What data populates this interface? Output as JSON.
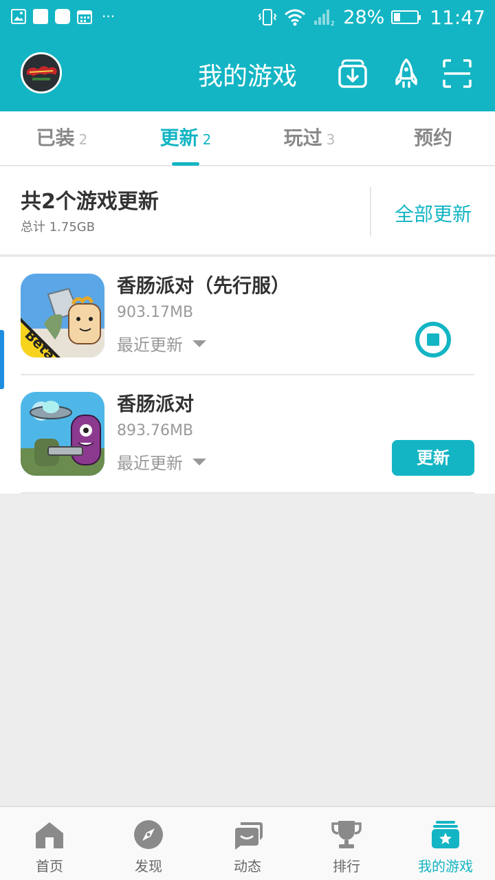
{
  "status_bar": {
    "battery_percent": "28%",
    "battery_level": 0.28,
    "time": "11:47",
    "icons": [
      "image-icon",
      "square-icon",
      "square-icon",
      "calendar-icon",
      "more-dots-icon",
      "vibrate-icon",
      "wifi-icon",
      "signal-icon"
    ]
  },
  "header": {
    "title": "我的游戏",
    "icons": [
      "download-manager-icon",
      "rocket-icon",
      "scan-icon"
    ]
  },
  "tabs": [
    {
      "label": "已装",
      "count": "2"
    },
    {
      "label": "更新",
      "count": "2",
      "active": true
    },
    {
      "label": "玩过",
      "count": "3"
    },
    {
      "label": "预约",
      "count": ""
    }
  ],
  "summary": {
    "title": "共2个游戏更新",
    "subtitle": "总计  1.75GB",
    "update_all_label": "全部更新"
  },
  "games": [
    {
      "name": "香肠派对（先行服）",
      "size": "903.17MB",
      "recent_label": "最近更新",
      "badge": "Beta",
      "action": "stop"
    },
    {
      "name": "香肠派对",
      "size": "893.76MB",
      "recent_label": "最近更新",
      "action_label": "更新"
    }
  ],
  "bottom_nav": [
    {
      "label": "首页",
      "icon": "home-icon"
    },
    {
      "label": "发现",
      "icon": "compass-icon"
    },
    {
      "label": "动态",
      "icon": "chat-icon"
    },
    {
      "label": "排行",
      "icon": "trophy-icon"
    },
    {
      "label": "我的游戏",
      "icon": "my-games-icon",
      "active": true
    }
  ],
  "colors": {
    "accent": "#13b5c4",
    "background": "#ededed",
    "scroll_indicator": "#1f8de0"
  }
}
